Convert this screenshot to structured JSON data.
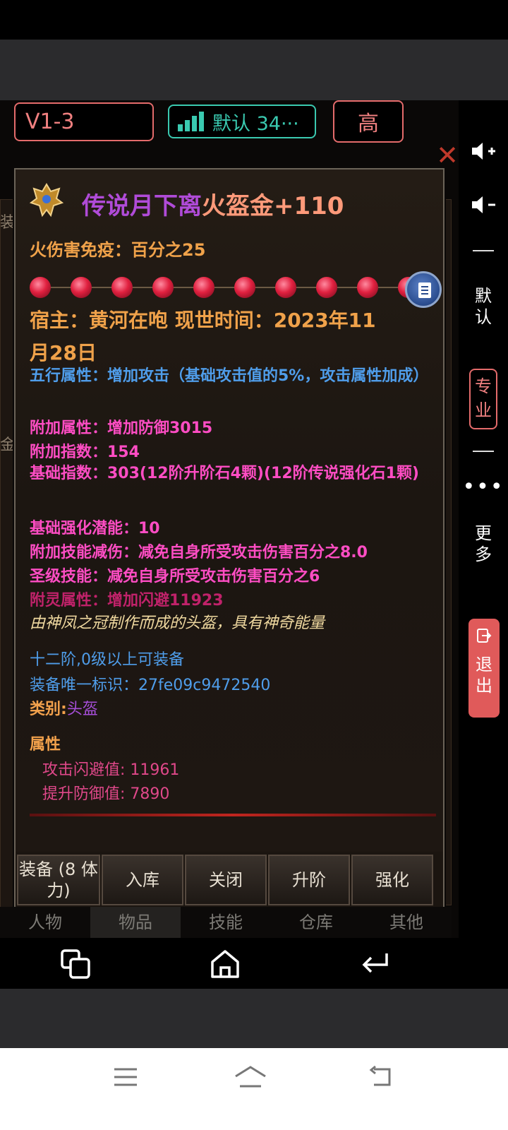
{
  "top_bar": {
    "server": "V1-3",
    "line_label": "默认 34···",
    "quality": "高"
  },
  "item": {
    "name_part1": "传说月下离",
    "name_part2": "火盔金+110",
    "fire_immunity": "火伤害免疫：百分之25",
    "owner_line_a": "宿主：黄河在咆 现世时间：2023年11",
    "owner_line_b": "月28日",
    "five_elements": "五行属性：增加攻击（基础攻击值的5%，攻击属性加成）",
    "extra_attr": "附加属性：增加防御3015",
    "extra_index": "附加指数：154",
    "base_index": "基础指数：303(12阶升阶石4颗)(12阶传说强化石1颗)",
    "base_enhance": "基础强化潜能：10",
    "skill_reduce": "附加技能减伤：减免自身所受攻击伤害百分之8.0",
    "holy_skill": "圣级技能：减免自身所受攻击伤害百分之6",
    "spirit_attr": "附灵属性：增加闪避11923",
    "flavor": "由神凤之冠制作而成的头盔，具有神奇能量",
    "requirement": "十二阶,0级以上可装备",
    "uid": "装备唯一标识：27fe09c9472540",
    "category_label": "类别:",
    "category_value": "头盔",
    "attr_title": "属性",
    "attr_dodge": "攻击闪避值: 11961",
    "attr_defense": "提升防御值: 7890"
  },
  "actions": {
    "equip": "装备 (8 体力)",
    "store": "入库",
    "close": "关闭",
    "upgrade": "升阶",
    "enhance": "强化"
  },
  "tabs": [
    "人物",
    "物品",
    "技能",
    "仓库",
    "其他"
  ],
  "side_menu": {
    "default": "默认",
    "pro": "专业",
    "more": "更多",
    "exit": "退出"
  },
  "bg_text": {
    "left_a": "装",
    "left_b": "金"
  },
  "colors": {
    "title_purple": "#b04bd8",
    "title_salmon": "#ff9a7a",
    "orange": "#f0a24a",
    "blue": "#4f9dea",
    "pink": "#ff4dc4",
    "magenta_dim": "#c0226a",
    "cream_italic": "#f0d9a0",
    "attr_orange": "#f2a14c",
    "attr_pink": "#e0488a"
  }
}
